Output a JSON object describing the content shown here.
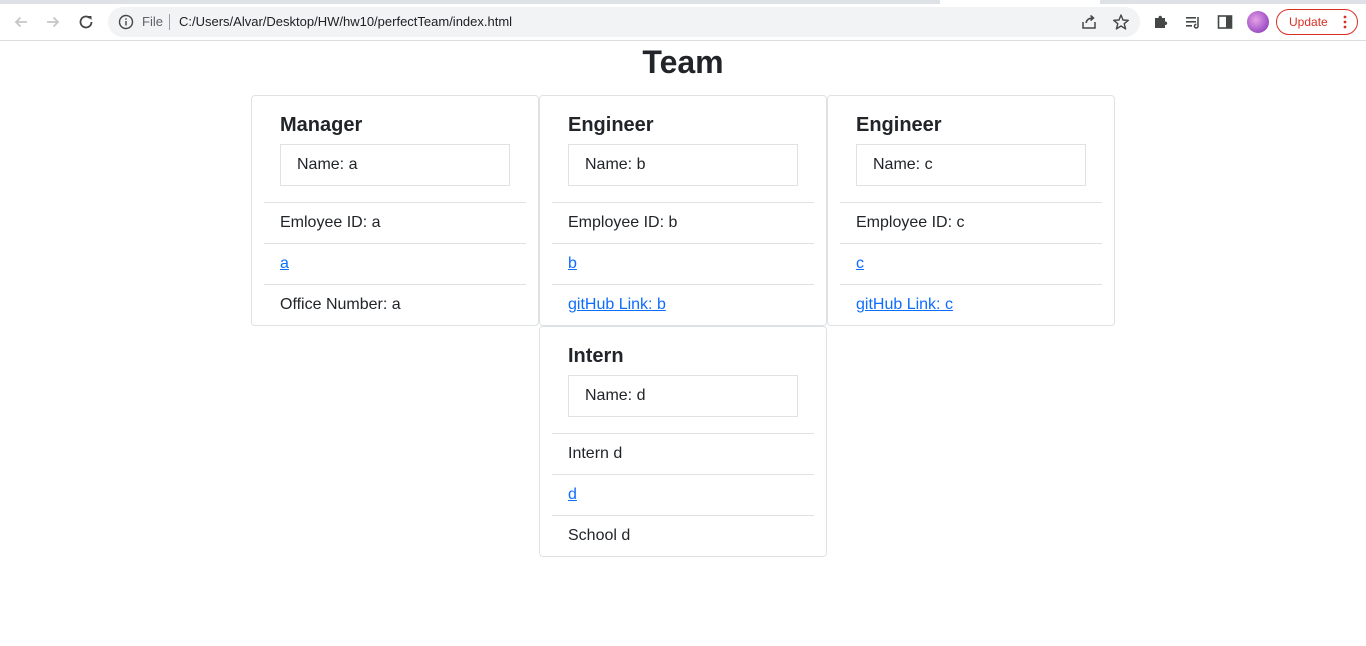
{
  "browser": {
    "scheme_label": "File",
    "url": "C:/Users/Alvar/Desktop/HW/hw10/perfectTeam/index.html",
    "update_label": "Update",
    "accent_color": "#d93025"
  },
  "page": {
    "title": "Team"
  },
  "cards": [
    {
      "title": "Manager",
      "name": "Name: a",
      "rows": [
        "Emloyee ID: a",
        "a",
        "Office Number: a"
      ]
    },
    {
      "title": "Engineer",
      "name": "Name: b",
      "rows": [
        "Employee ID: b",
        "b",
        "gitHub Link: b"
      ]
    },
    {
      "title": "Engineer",
      "name": "Name: c",
      "rows": [
        "Employee ID: c",
        "c",
        "gitHub Link: c"
      ]
    },
    {
      "title": "Intern",
      "name": "Name: d",
      "rows": [
        "Intern d",
        "d",
        "School d"
      ]
    }
  ],
  "icons": {
    "back": "back-arrow-icon",
    "forward": "forward-arrow-icon",
    "reload": "reload-icon",
    "info": "info-icon",
    "share": "share-icon",
    "bookmark": "star-icon",
    "extensions": "puzzle-icon",
    "reading_list": "reading-list-icon",
    "side_panel": "side-panel-icon",
    "menu": "kebab-menu-icon"
  }
}
